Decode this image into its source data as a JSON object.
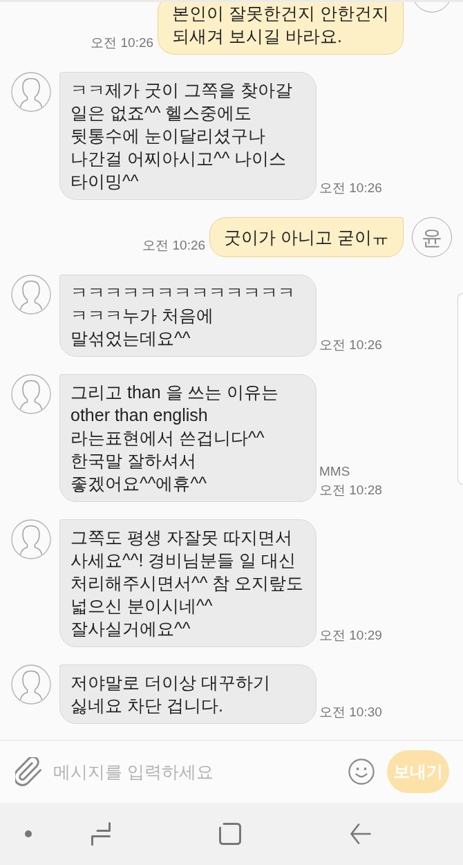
{
  "messages": [
    {
      "kind": "sent",
      "text": "본인이 잘못한건지 안한건지\n되새겨 보시길 바라요.",
      "time": "오전 10:26"
    },
    {
      "kind": "received",
      "text": "ㅋㅋ제가 굿이 그쪽을 찾아갈\n일은 없죠^^ 헬스중에도\n뒷통수에 눈이달리셨구나\n나간걸 어찌아시고^^ 나이스\n타이밍^^",
      "time": "오전 10:26"
    },
    {
      "kind": "sent",
      "text": "굿이가 아니고 굳이ㅠ",
      "time": "오전 10:26",
      "avatar": "윤"
    },
    {
      "kind": "received",
      "text": "ㅋㅋㅋㅋㅋㅋㅋㅋㅋㅋㅋㅋㅋㅋㅋㅋ누가 처음에\n말섞었는데요^^",
      "time": "오전 10:26"
    },
    {
      "kind": "received",
      "text": "그리고 than 을 쓰는 이유는\nother than english\n라는표현에서 쓴겁니다^^\n한국말 잘하셔서\n좋겠어요^^에휴^^",
      "type_label": "MMS",
      "time": "오전 10:28"
    },
    {
      "kind": "received",
      "text": "그쪽도 평생 자잘못 따지면서\n사세요^^! 경비님분들 일 대신\n처리해주시면서^^ 참 오지랖도\n넓으신 분이시네^^\n잘사실거에요^^",
      "time": "오전 10:29"
    },
    {
      "kind": "received",
      "text": "저야말로 더이상 대꾸하기\n싫네요 차단 겁니다.",
      "time": "오전 10:30"
    }
  ],
  "composer": {
    "placeholder": "메시지를 입력하세요",
    "send_button": {
      "label": "보내기",
      "disabled": true
    }
  }
}
